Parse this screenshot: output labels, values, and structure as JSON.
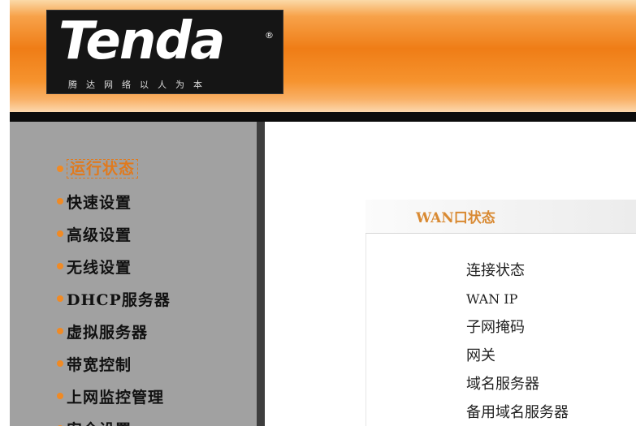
{
  "header": {
    "logo_text": "Tenda",
    "logo_registered": "®",
    "slogan": "腾达网络以人为本"
  },
  "sidebar": {
    "items": [
      {
        "label": "运行状态",
        "active": true
      },
      {
        "label": "快速设置"
      },
      {
        "label": "高级设置"
      },
      {
        "label": "无线设置"
      },
      {
        "label": "DHCP服务器"
      },
      {
        "label": "虚拟服务器"
      },
      {
        "label": "带宽控制"
      },
      {
        "label": "上网监控管理"
      },
      {
        "label": "安全设置"
      }
    ]
  },
  "main": {
    "panel_title": "WAN口状态",
    "fields": [
      {
        "label": "连接状态"
      },
      {
        "label": "WAN IP"
      },
      {
        "label": "子网掩码"
      },
      {
        "label": "网关"
      },
      {
        "label": "域名服务器"
      },
      {
        "label": "备用域名服务器"
      }
    ]
  },
  "colors": {
    "header_orange": "#ef7d16",
    "accent": "#f08a24",
    "sidebar_bg": "#a1a1a1",
    "panel_title": "#d98a33"
  }
}
